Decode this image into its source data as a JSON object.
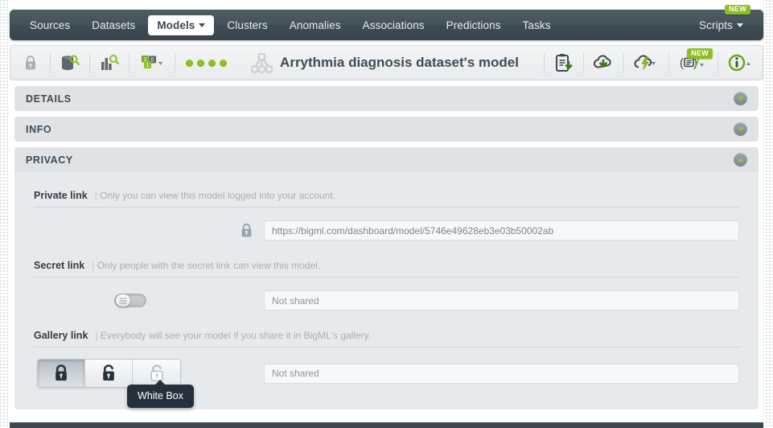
{
  "nav": {
    "items": [
      {
        "label": "Sources",
        "active": false,
        "caret": false
      },
      {
        "label": "Datasets",
        "active": false,
        "caret": false
      },
      {
        "label": "Models",
        "active": true,
        "caret": true
      },
      {
        "label": "Clusters",
        "active": false,
        "caret": false
      },
      {
        "label": "Anomalies",
        "active": false,
        "caret": false
      },
      {
        "label": "Associations",
        "active": false,
        "caret": false
      },
      {
        "label": "Predictions",
        "active": false,
        "caret": false
      },
      {
        "label": "Tasks",
        "active": false,
        "caret": false
      }
    ],
    "right": {
      "label": "Scripts",
      "badge": "NEW"
    }
  },
  "toolbar": {
    "title": "Arrythmia diagnosis dataset's model",
    "privacy_lock_icon": "lock-icon",
    "dataset_icon": "dataset-search-icon",
    "histogram_icon": "histogram-search-icon",
    "fields_icon": "fields-count-icon",
    "status_dots": 4,
    "status_dot_color": "#8ec31f",
    "download_icon": "clipboard-download-icon",
    "cloud_icon": "cloud-download-icon",
    "action_icon": "lightning-cloud-icon",
    "script_icon": "script-icon",
    "info_icon": "info-circle-icon",
    "script_badge": "NEW"
  },
  "sections": [
    {
      "id": "details",
      "title": "DETAILS",
      "expanded": false
    },
    {
      "id": "info",
      "title": "INFO",
      "expanded": false
    },
    {
      "id": "privacy",
      "title": "PRIVACY",
      "expanded": true
    }
  ],
  "privacy": {
    "private": {
      "label": "Private link",
      "description": "Only you can view this model logged into your account.",
      "icon": "lock-icon",
      "url": "https://bigml.com/dashboard/model/5746e49628eb3e03b50002ab"
    },
    "secret": {
      "label": "Secret link",
      "description": "Only people with the secret link can view this model.",
      "toggle_state": "off",
      "value": "Not shared"
    },
    "gallery": {
      "label": "Gallery link",
      "description": "Everybody will see your model if you share it in BigML's gallery.",
      "value": "Not shared",
      "buttons": [
        {
          "name": "private-lock",
          "icon": "closed-lock-icon",
          "selected": true
        },
        {
          "name": "black-box",
          "icon": "open-lock-dark-icon",
          "selected": false
        },
        {
          "name": "white-box",
          "icon": "open-lock-white-icon",
          "selected": false
        }
      ],
      "tooltip": "White Box"
    }
  },
  "colors": {
    "accent_green": "#8fbe23",
    "nav_dark": "#3e4b53",
    "tooltip_bg": "#24313c"
  }
}
